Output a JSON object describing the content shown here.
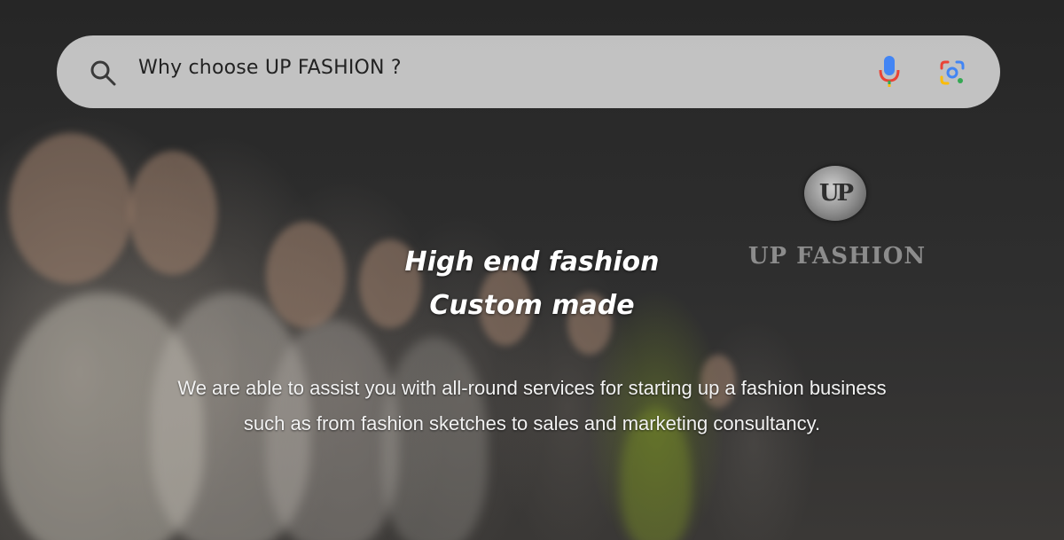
{
  "search": {
    "query": "Why choose UP FASHION  ?"
  },
  "logo": {
    "emblem": "UP",
    "name": "UP FASHION"
  },
  "hero": {
    "headline_line1": "High end fashion",
    "headline_line2": "Custom made",
    "body_line1": "We are able to assist you with all-round services for starting up a fashion business",
    "body_line2": "such as from fashion sketches to sales and marketing consultancy."
  },
  "icons": {
    "search": "search-icon",
    "voice": "microphone-icon",
    "lens": "camera-lens-icon"
  },
  "colors": {
    "search_bar_bg": "#d7d7d7",
    "headline": "#ffffff",
    "mic_blue": "#4285F4",
    "mic_red": "#EA4335",
    "lens_green": "#34A853",
    "lens_yellow": "#FBBC05"
  }
}
